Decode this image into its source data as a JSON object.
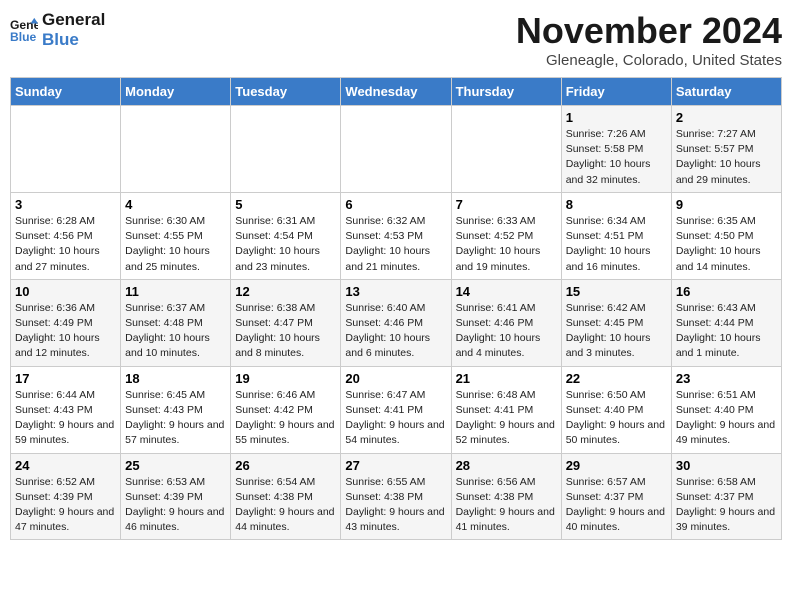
{
  "header": {
    "logo_line1": "General",
    "logo_line2": "Blue",
    "month": "November 2024",
    "location": "Gleneagle, Colorado, United States"
  },
  "days_of_week": [
    "Sunday",
    "Monday",
    "Tuesday",
    "Wednesday",
    "Thursday",
    "Friday",
    "Saturday"
  ],
  "weeks": [
    [
      {
        "day": "",
        "info": ""
      },
      {
        "day": "",
        "info": ""
      },
      {
        "day": "",
        "info": ""
      },
      {
        "day": "",
        "info": ""
      },
      {
        "day": "",
        "info": ""
      },
      {
        "day": "1",
        "info": "Sunrise: 7:26 AM\nSunset: 5:58 PM\nDaylight: 10 hours and 32 minutes."
      },
      {
        "day": "2",
        "info": "Sunrise: 7:27 AM\nSunset: 5:57 PM\nDaylight: 10 hours and 29 minutes."
      }
    ],
    [
      {
        "day": "3",
        "info": "Sunrise: 6:28 AM\nSunset: 4:56 PM\nDaylight: 10 hours and 27 minutes."
      },
      {
        "day": "4",
        "info": "Sunrise: 6:30 AM\nSunset: 4:55 PM\nDaylight: 10 hours and 25 minutes."
      },
      {
        "day": "5",
        "info": "Sunrise: 6:31 AM\nSunset: 4:54 PM\nDaylight: 10 hours and 23 minutes."
      },
      {
        "day": "6",
        "info": "Sunrise: 6:32 AM\nSunset: 4:53 PM\nDaylight: 10 hours and 21 minutes."
      },
      {
        "day": "7",
        "info": "Sunrise: 6:33 AM\nSunset: 4:52 PM\nDaylight: 10 hours and 19 minutes."
      },
      {
        "day": "8",
        "info": "Sunrise: 6:34 AM\nSunset: 4:51 PM\nDaylight: 10 hours and 16 minutes."
      },
      {
        "day": "9",
        "info": "Sunrise: 6:35 AM\nSunset: 4:50 PM\nDaylight: 10 hours and 14 minutes."
      }
    ],
    [
      {
        "day": "10",
        "info": "Sunrise: 6:36 AM\nSunset: 4:49 PM\nDaylight: 10 hours and 12 minutes."
      },
      {
        "day": "11",
        "info": "Sunrise: 6:37 AM\nSunset: 4:48 PM\nDaylight: 10 hours and 10 minutes."
      },
      {
        "day": "12",
        "info": "Sunrise: 6:38 AM\nSunset: 4:47 PM\nDaylight: 10 hours and 8 minutes."
      },
      {
        "day": "13",
        "info": "Sunrise: 6:40 AM\nSunset: 4:46 PM\nDaylight: 10 hours and 6 minutes."
      },
      {
        "day": "14",
        "info": "Sunrise: 6:41 AM\nSunset: 4:46 PM\nDaylight: 10 hours and 4 minutes."
      },
      {
        "day": "15",
        "info": "Sunrise: 6:42 AM\nSunset: 4:45 PM\nDaylight: 10 hours and 3 minutes."
      },
      {
        "day": "16",
        "info": "Sunrise: 6:43 AM\nSunset: 4:44 PM\nDaylight: 10 hours and 1 minute."
      }
    ],
    [
      {
        "day": "17",
        "info": "Sunrise: 6:44 AM\nSunset: 4:43 PM\nDaylight: 9 hours and 59 minutes."
      },
      {
        "day": "18",
        "info": "Sunrise: 6:45 AM\nSunset: 4:43 PM\nDaylight: 9 hours and 57 minutes."
      },
      {
        "day": "19",
        "info": "Sunrise: 6:46 AM\nSunset: 4:42 PM\nDaylight: 9 hours and 55 minutes."
      },
      {
        "day": "20",
        "info": "Sunrise: 6:47 AM\nSunset: 4:41 PM\nDaylight: 9 hours and 54 minutes."
      },
      {
        "day": "21",
        "info": "Sunrise: 6:48 AM\nSunset: 4:41 PM\nDaylight: 9 hours and 52 minutes."
      },
      {
        "day": "22",
        "info": "Sunrise: 6:50 AM\nSunset: 4:40 PM\nDaylight: 9 hours and 50 minutes."
      },
      {
        "day": "23",
        "info": "Sunrise: 6:51 AM\nSunset: 4:40 PM\nDaylight: 9 hours and 49 minutes."
      }
    ],
    [
      {
        "day": "24",
        "info": "Sunrise: 6:52 AM\nSunset: 4:39 PM\nDaylight: 9 hours and 47 minutes."
      },
      {
        "day": "25",
        "info": "Sunrise: 6:53 AM\nSunset: 4:39 PM\nDaylight: 9 hours and 46 minutes."
      },
      {
        "day": "26",
        "info": "Sunrise: 6:54 AM\nSunset: 4:38 PM\nDaylight: 9 hours and 44 minutes."
      },
      {
        "day": "27",
        "info": "Sunrise: 6:55 AM\nSunset: 4:38 PM\nDaylight: 9 hours and 43 minutes."
      },
      {
        "day": "28",
        "info": "Sunrise: 6:56 AM\nSunset: 4:38 PM\nDaylight: 9 hours and 41 minutes."
      },
      {
        "day": "29",
        "info": "Sunrise: 6:57 AM\nSunset: 4:37 PM\nDaylight: 9 hours and 40 minutes."
      },
      {
        "day": "30",
        "info": "Sunrise: 6:58 AM\nSunset: 4:37 PM\nDaylight: 9 hours and 39 minutes."
      }
    ]
  ]
}
